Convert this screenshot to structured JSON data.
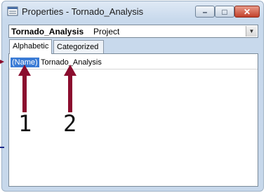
{
  "window": {
    "title": "Properties - Tornado_Analysis",
    "icon": "properties-window-icon",
    "buttons": {
      "minimize": "–",
      "maximize": "□",
      "close": "✕"
    }
  },
  "object_selector": {
    "object_name": "Tornado_Analysis",
    "object_type": "Project",
    "dropdown_icon": "chevron-down-icon"
  },
  "tabs": [
    {
      "label": "Alphabetic",
      "selected": true
    },
    {
      "label": "Categorized",
      "selected": false
    }
  ],
  "properties": [
    {
      "name": "(Name)",
      "value": "Tornado_Analysis"
    }
  ],
  "annotations": {
    "label_1": "1",
    "label_2": "2",
    "arrow_color": "#8b0d2e"
  }
}
